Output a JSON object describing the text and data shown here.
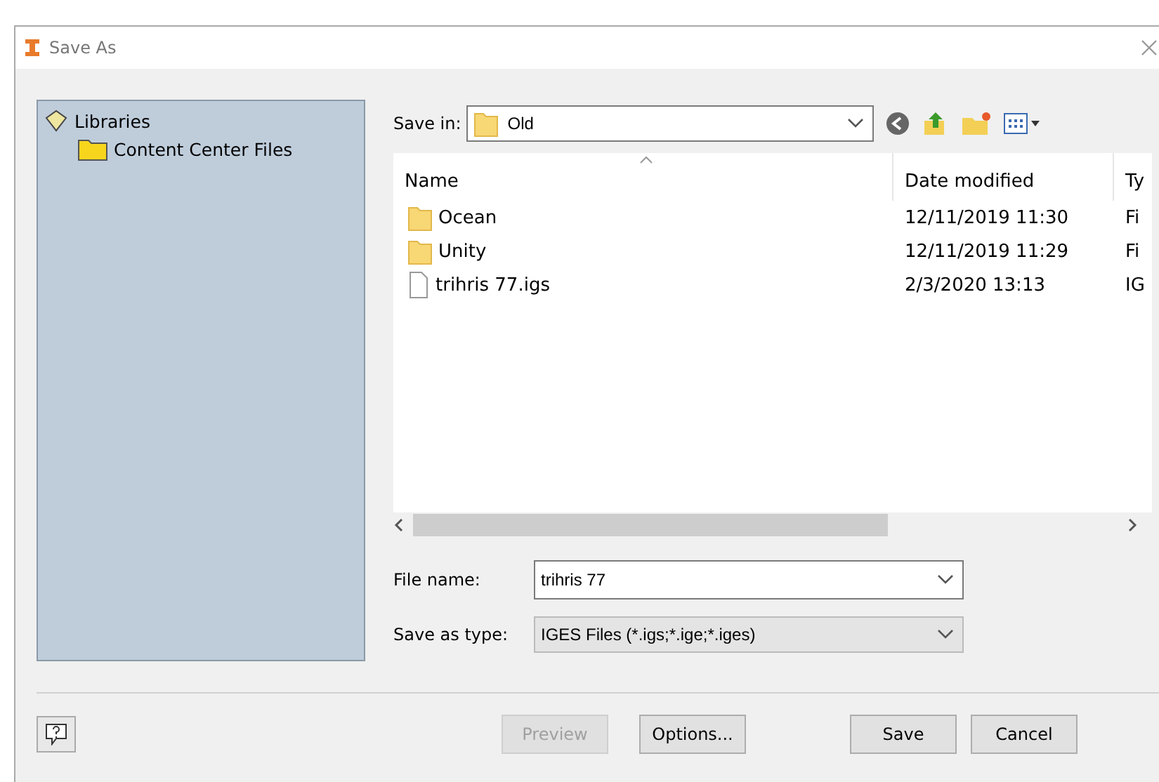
{
  "window": {
    "title": "Save As"
  },
  "sidebar": {
    "items": [
      {
        "label": "Libraries",
        "kind": "library",
        "children": [
          {
            "label": "Content Center Files",
            "kind": "folder"
          }
        ]
      }
    ]
  },
  "save_in": {
    "label": "Save in:",
    "value": "Old"
  },
  "table": {
    "columns": [
      "Name",
      "Date modified",
      "Ty"
    ],
    "rows": [
      {
        "kind": "folder",
        "cells": [
          "Ocean",
          "12/11/2019 11:30",
          "Fi"
        ]
      },
      {
        "kind": "folder",
        "cells": [
          "Unity",
          "12/11/2019 11:29",
          "Fi"
        ]
      },
      {
        "kind": "file",
        "cells": [
          "trihris 77.igs",
          "2/3/2020 13:13",
          "IG"
        ]
      }
    ]
  },
  "file_name": {
    "label": "File name:",
    "value": "trihris 77"
  },
  "save_as_type": {
    "label": "Save as type:",
    "value": "IGES Files (*.igs;*.ige;*.iges)"
  },
  "buttons": [
    {
      "label": "Preview",
      "disabled": true
    },
    {
      "label": "Options...",
      "disabled": false
    },
    {
      "label": "Save",
      "disabled": false
    },
    {
      "label": "Cancel",
      "disabled": false
    }
  ]
}
